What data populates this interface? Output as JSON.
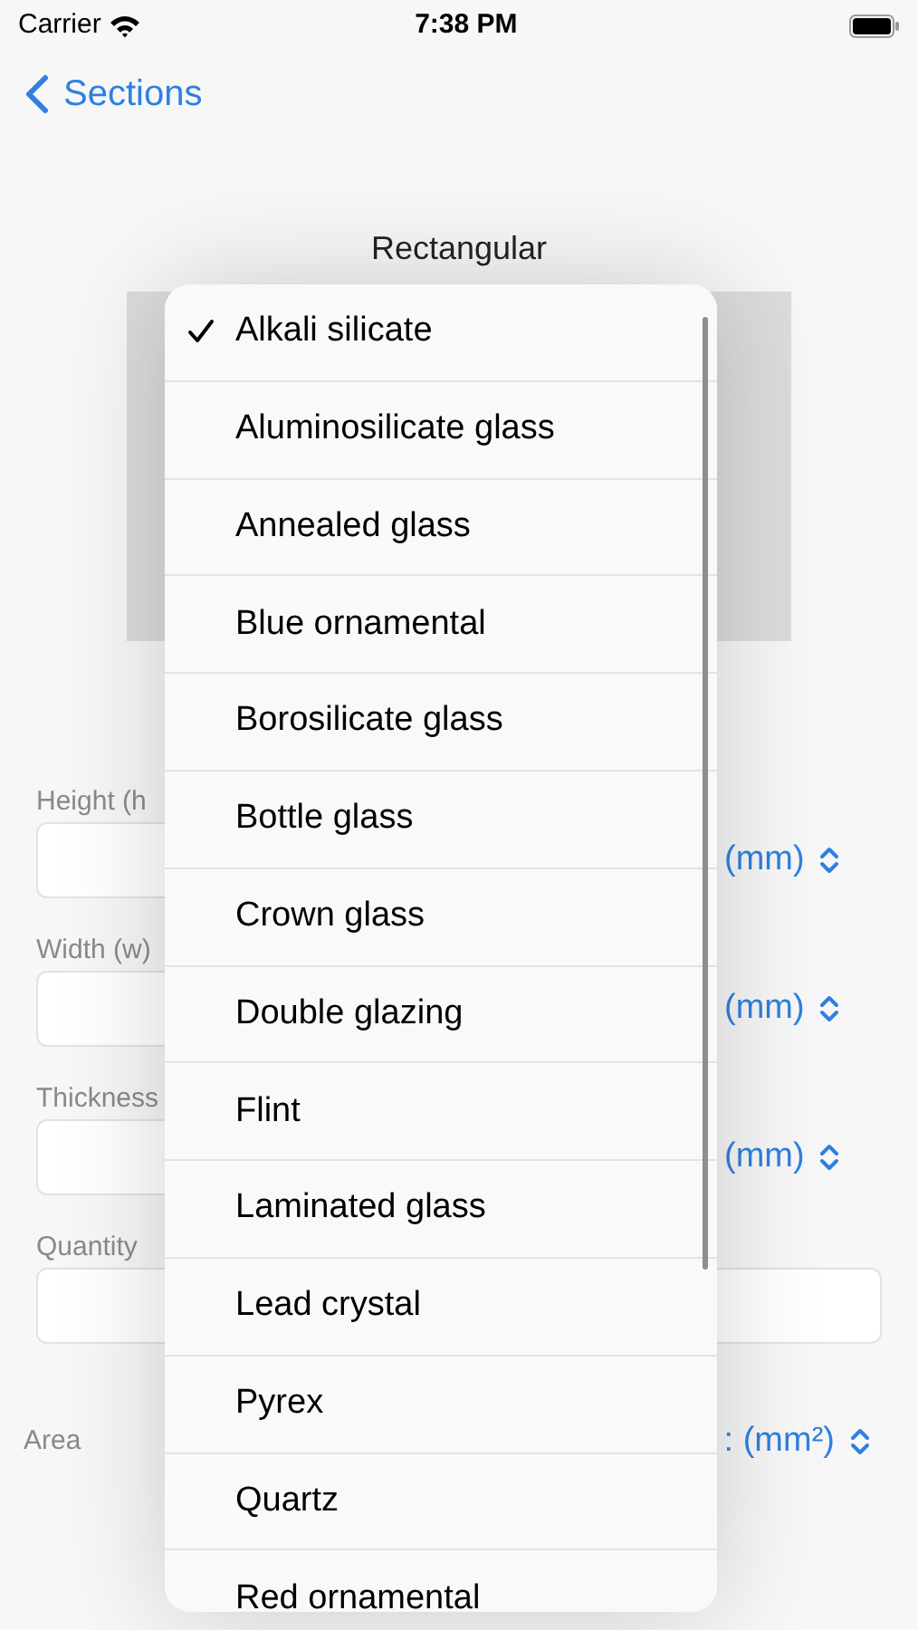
{
  "status_bar": {
    "carrier": "Carrier",
    "time": "7:38 PM"
  },
  "nav": {
    "back": "Sections"
  },
  "section_title": "Rectangular",
  "fields": [
    {
      "label": "Height (h",
      "unit": "(mm)"
    },
    {
      "label": "Width (w)",
      "unit": "(mm)"
    },
    {
      "label": "Thickness",
      "unit": "(mm)"
    },
    {
      "label": "Quantity"
    }
  ],
  "result": {
    "label": "Area",
    "unit": ": (mm²)"
  },
  "menu": [
    {
      "label": "Alkali silicate",
      "selected": true
    },
    {
      "label": "Aluminosilicate glass",
      "selected": false
    },
    {
      "label": "Annealed glass",
      "selected": false
    },
    {
      "label": "Blue ornamental",
      "selected": false
    },
    {
      "label": "Borosilicate glass",
      "selected": false
    },
    {
      "label": "Bottle glass",
      "selected": false
    },
    {
      "label": "Crown glass",
      "selected": false
    },
    {
      "label": "Double glazing",
      "selected": false
    },
    {
      "label": "Flint",
      "selected": false
    },
    {
      "label": "Laminated glass",
      "selected": false
    },
    {
      "label": "Lead crystal",
      "selected": false
    },
    {
      "label": "Pyrex",
      "selected": false
    },
    {
      "label": "Quartz",
      "selected": false
    },
    {
      "label": "Red ornamental",
      "selected": false
    }
  ]
}
